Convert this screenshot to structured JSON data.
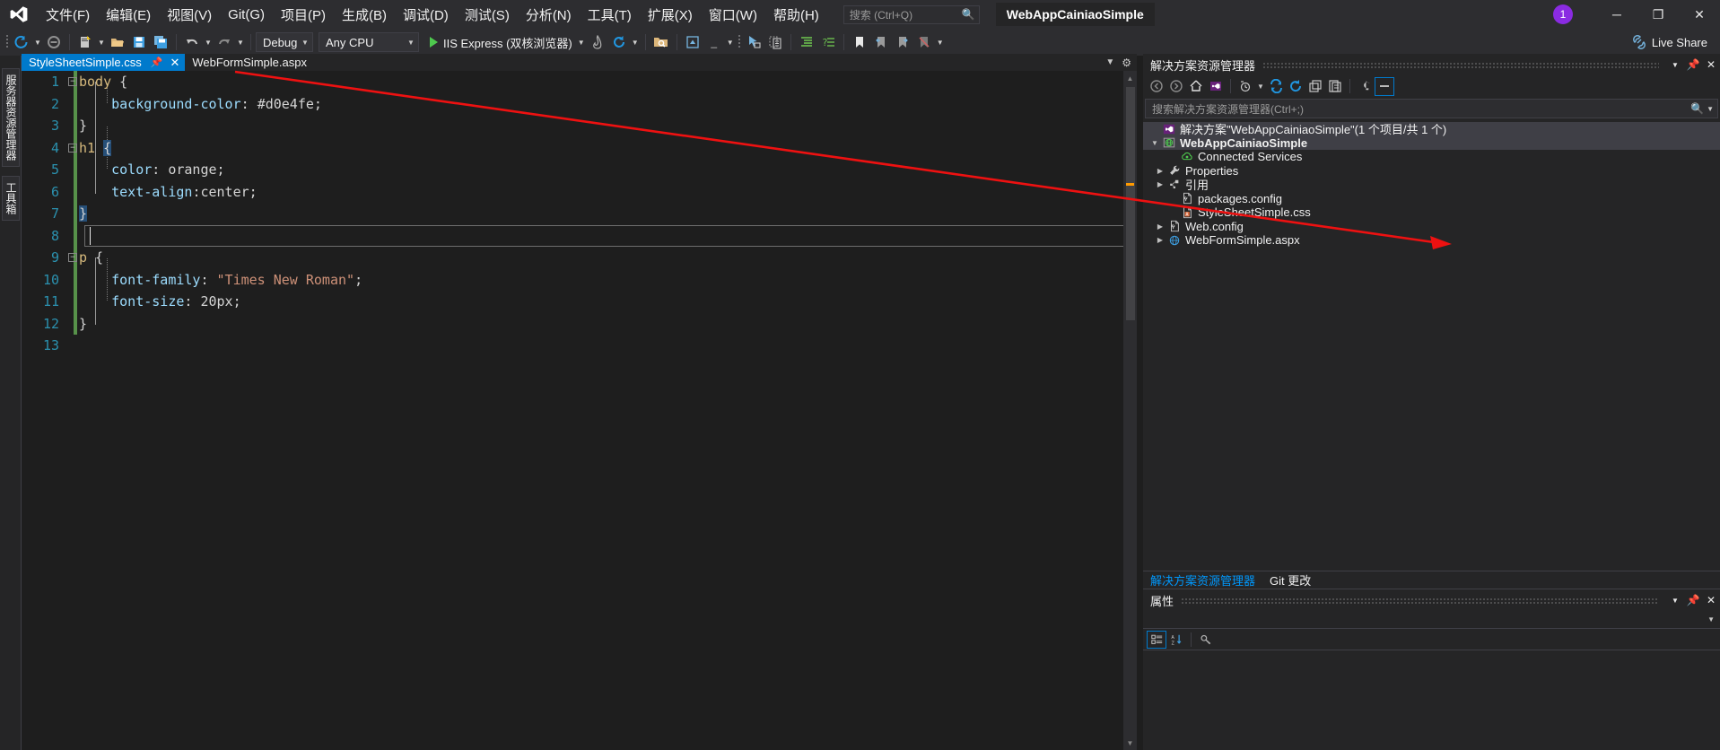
{
  "window": {
    "title": "WebAppCainiaoSimple",
    "notification_count": "1",
    "minimize": "─",
    "restore": "❐",
    "close": "✕"
  },
  "menu": {
    "items": [
      {
        "label": "文件(F)",
        "name": "menu-file"
      },
      {
        "label": "编辑(E)",
        "name": "menu-edit"
      },
      {
        "label": "视图(V)",
        "name": "menu-view"
      },
      {
        "label": "Git(G)",
        "name": "menu-git"
      },
      {
        "label": "项目(P)",
        "name": "menu-project"
      },
      {
        "label": "生成(B)",
        "name": "menu-build"
      },
      {
        "label": "调试(D)",
        "name": "menu-debug"
      },
      {
        "label": "测试(S)",
        "name": "menu-test"
      },
      {
        "label": "分析(N)",
        "name": "menu-analyze"
      },
      {
        "label": "工具(T)",
        "name": "menu-tools"
      },
      {
        "label": "扩展(X)",
        "name": "menu-extensions"
      },
      {
        "label": "窗口(W)",
        "name": "menu-window"
      },
      {
        "label": "帮助(H)",
        "name": "menu-help"
      }
    ],
    "search_placeholder": "搜索 (Ctrl+Q)"
  },
  "toolbar": {
    "configuration": "Debug",
    "platform": "Any CPU",
    "run_target": "IIS Express (双核浏览器)",
    "live_share": "Live Share"
  },
  "tabs": [
    {
      "label": "StyleSheetSimple.css",
      "active": true,
      "name": "tab-stylesheetsimple-css"
    },
    {
      "label": "WebFormSimple.aspx",
      "active": false,
      "name": "tab-webformsimple-aspx"
    }
  ],
  "left_dock": {
    "tabs": [
      {
        "label": "服务器资源管理器",
        "name": "vtab-server-explorer"
      },
      {
        "label": "工具箱",
        "name": "vtab-toolbox"
      }
    ]
  },
  "editor": {
    "language": "css",
    "cursor_line": 8,
    "lines": [
      {
        "n": "1",
        "fold": "minus",
        "text": "body {"
      },
      {
        "n": "2",
        "fold": "",
        "text": "    background-color: #d0e4fe;"
      },
      {
        "n": "3",
        "fold": "",
        "text": "}"
      },
      {
        "n": "4",
        "fold": "minus",
        "text": "h1 {"
      },
      {
        "n": "5",
        "fold": "",
        "text": "    color: orange;"
      },
      {
        "n": "6",
        "fold": "",
        "text": "    text-align:center;"
      },
      {
        "n": "7",
        "fold": "",
        "text": "}"
      },
      {
        "n": "8",
        "fold": "",
        "text": ""
      },
      {
        "n": "9",
        "fold": "minus",
        "text": "p {"
      },
      {
        "n": "10",
        "fold": "",
        "text": "    font-family: \"Times New Roman\";"
      },
      {
        "n": "11",
        "fold": "",
        "text": "    font-size: 20px;"
      },
      {
        "n": "12",
        "fold": "",
        "text": "}"
      },
      {
        "n": "13",
        "fold": "",
        "text": ""
      }
    ],
    "tokens": {
      "l1_sel": "body",
      "l1_brace": " {",
      "l2_prop": "background-color",
      "l2_colon": ": ",
      "l2_val": "#d0e4fe",
      "l2_semi": ";",
      "l3_brace": "}",
      "l4_sel": "h1",
      "l4_sp": " ",
      "l4_brace": "{",
      "l5_prop": "color",
      "l5_colon": ": ",
      "l5_val": "orange",
      "l5_semi": ";",
      "l6_prop": "text-align",
      "l6_colon": ":",
      "l6_val": "center",
      "l6_semi": ";",
      "l7_brace": "}",
      "l9_sel": "p",
      "l9_brace": " {",
      "l10_prop": "font-family",
      "l10_colon": ": ",
      "l10_val": "\"Times New Roman\"",
      "l10_semi": ";",
      "l11_prop": "font-size",
      "l11_colon": ": ",
      "l11_val": "20px",
      "l11_semi": ";",
      "l12_brace": "}"
    },
    "colors": {
      "selector": "#d7ba7d",
      "property": "#9cdcfe",
      "value": "#d4d4d4",
      "string": "#ce9178",
      "line_number": "#2b91af",
      "background": "#1e1e1e",
      "changed_bar": "#57924a"
    }
  },
  "solution_explorer": {
    "title": "解决方案资源管理器",
    "search_placeholder": "搜索解决方案资源管理器(Ctrl+;)",
    "tree": [
      {
        "label": "解决方案\"WebAppCainiaoSimple\"(1 个项目/共 1 个)",
        "indent": 0,
        "twisty": "",
        "icon": "solution-icon",
        "bold": false,
        "name": "tree-item-solution"
      },
      {
        "label": "WebAppCainiaoSimple",
        "indent": 1,
        "twisty": "down",
        "icon": "project-web-icon",
        "bold": true,
        "name": "tree-item-project"
      },
      {
        "label": "Connected Services",
        "indent": 2,
        "twisty": "",
        "icon": "connected-services-icon",
        "bold": false,
        "name": "tree-item-connected-services"
      },
      {
        "label": "Properties",
        "indent": 2,
        "twisty": "right",
        "icon": "wrench-icon",
        "bold": false,
        "name": "tree-item-properties"
      },
      {
        "label": "引用",
        "indent": 2,
        "twisty": "right",
        "icon": "references-icon",
        "bold": false,
        "name": "tree-item-references"
      },
      {
        "label": "packages.config",
        "indent": 2,
        "twisty": "",
        "icon": "config-file-icon",
        "bold": false,
        "name": "tree-item-packages-config"
      },
      {
        "label": "StyleSheetSimple.css",
        "indent": 2,
        "twisty": "",
        "icon": "css-file-icon",
        "bold": false,
        "name": "tree-item-stylesheetsimple-css"
      },
      {
        "label": "Web.config",
        "indent": 2,
        "twisty": "right",
        "icon": "config-file-icon",
        "bold": false,
        "name": "tree-item-web-config"
      },
      {
        "label": "WebFormSimple.aspx",
        "indent": 2,
        "twisty": "right",
        "icon": "aspx-file-icon",
        "bold": false,
        "name": "tree-item-webformsimple-aspx"
      }
    ]
  },
  "dock_tabs": [
    {
      "label": "解决方案资源管理器",
      "active": true,
      "name": "dock-tab-solution-explorer"
    },
    {
      "label": "Git 更改",
      "active": false,
      "name": "dock-tab-git-changes"
    }
  ],
  "properties": {
    "title": "属性"
  },
  "annotation": {
    "color": "#ee1111",
    "from": "tab-stylesheetsimple-css",
    "to": "tree-item-stylesheetsimple-css"
  }
}
